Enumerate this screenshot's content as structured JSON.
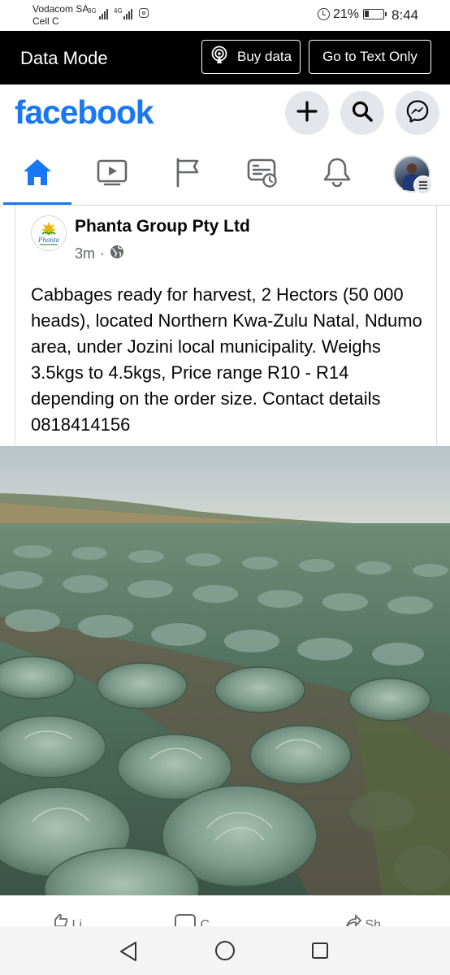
{
  "status_bar": {
    "carrier_line1": "Vodacom SA",
    "carrier_line2": "Cell C",
    "sim1_network": "3G",
    "sim2_network": "4G",
    "battery_percent": "21%",
    "time": "8:44"
  },
  "data_mode_bar": {
    "title": "Data Mode",
    "buy_data_label": "Buy data",
    "text_only_label": "Go to Text Only"
  },
  "header": {
    "logo_text": "facebook",
    "brand_color": "#1877f2"
  },
  "nav": {
    "items": [
      "home-icon",
      "video-icon",
      "pages-flag-icon",
      "memories-icon",
      "notifications-bell-icon",
      "profile-menu-avatar"
    ],
    "active_index": 0
  },
  "post": {
    "page_name": "Phanta Group Pty Ltd",
    "avatar_logo_text": "Phanta",
    "time_ago": "3m",
    "separator": "·",
    "audience_icon": "globe-icon",
    "text": "Cabbages ready for harvest, 2 Hectors (50 000 heads), located Northern Kwa-Zulu Natal, Ndumo area, under Jozini local municipality. Weighs 3.5kgs to 4.5kgs, Price range R10 - R14 depending on the order size. Contact details 0818414156",
    "photo_subject": "cabbage-field-photo"
  },
  "post_actions": {
    "like": "Li",
    "comment": "C",
    "share": "Sh"
  },
  "android_nav": [
    "back-icon",
    "home-circle-icon",
    "recents-square-icon"
  ]
}
